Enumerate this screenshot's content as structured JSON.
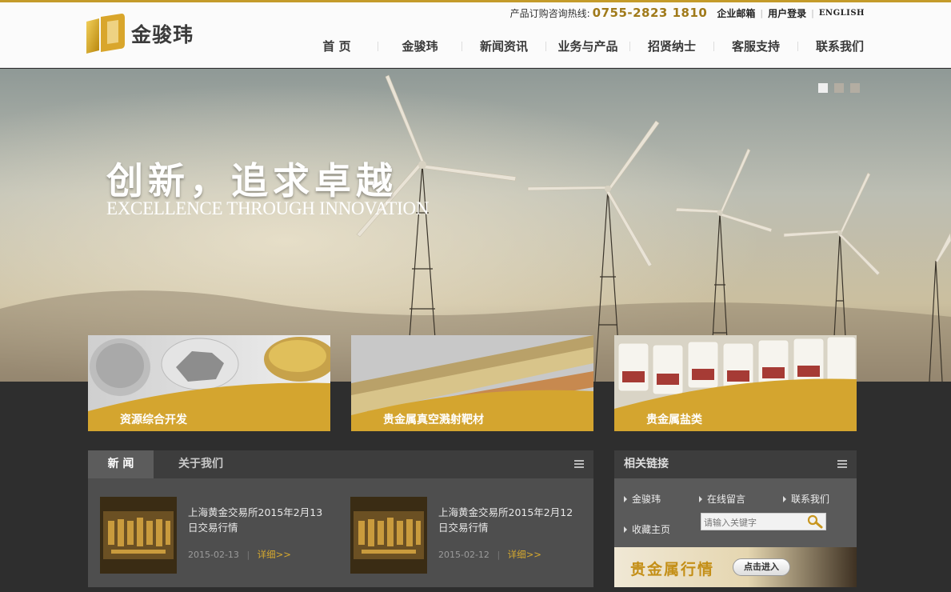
{
  "header": {
    "logo_text": "金骏玮",
    "hotline_label": "产品订购咨询热线:",
    "hotline_number": "0755-2823 1810",
    "toplinks": [
      "企业邮箱",
      "用户登录",
      "ENGLISH"
    ]
  },
  "nav": {
    "items": [
      "首 页",
      "金骏玮",
      "新闻资讯",
      "业务与产品",
      "招贤纳士",
      "客服支持",
      "联系我们"
    ]
  },
  "hero": {
    "title": "创新，追求卓越",
    "subtitle": "EXCELLENCE THROUGH INNOVATION",
    "slides_total": 3,
    "active_slide": 1
  },
  "tiles": [
    {
      "label": "资源综合开发"
    },
    {
      "label": "贵金属真空溅射靶材"
    },
    {
      "label": "贵金属盐类"
    }
  ],
  "news_panel": {
    "tabs": [
      "新 闻",
      "关于我们"
    ],
    "items": [
      {
        "title": "上海黄金交易所2015年2月13日交易行情",
        "date": "2015-02-13",
        "more": "详细>>"
      },
      {
        "title": "上海黄金交易所2015年2月12日交易行情",
        "date": "2015-02-12",
        "more": "详细>>"
      }
    ]
  },
  "links_panel": {
    "title": "相关链接",
    "links": [
      "金骏玮",
      "在线留言",
      "联系我们",
      "收藏主页"
    ],
    "search_placeholder": "请输入关键字",
    "banner_text": "贵金属行情",
    "banner_button": "点击进入"
  },
  "colors": {
    "accent": "#c49b2a",
    "tile": "#d4a52f",
    "dark_bg": "#2e2e2e"
  }
}
